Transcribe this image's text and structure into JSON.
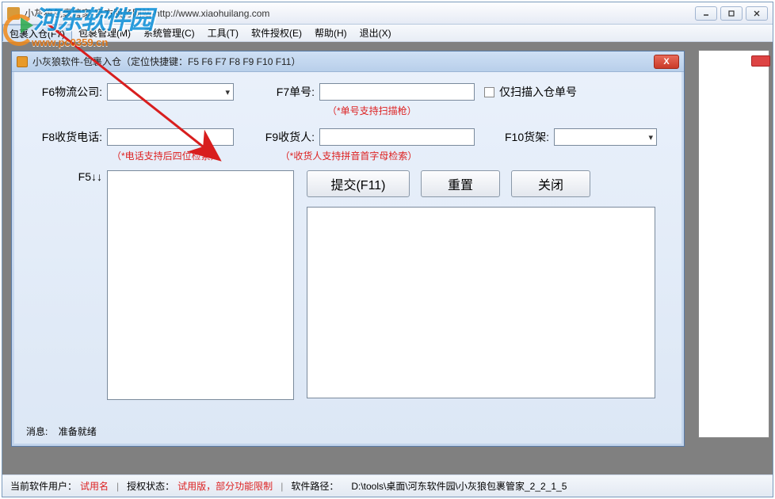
{
  "outer": {
    "title": "小灰狼包裹管家-官方服务网站-http://www.xiaohuilang.com"
  },
  "menu": {
    "items": [
      "包裹入仓(F7)",
      "包裹管理(M)",
      "系统管理(C)",
      "工具(T)",
      "软件授权(E)",
      "帮助(H)",
      "退出(X)"
    ]
  },
  "dialog": {
    "title": "小灰狼软件-包裹入仓（定位快捷键：F5 F6 F7 F8 F9 F10 F11）",
    "f6_label": "F6物流公司:",
    "f7_label": "F7单号:",
    "f7_hint": "（*单号支持扫描枪）",
    "scan_only_label": "仅扫描入仓单号",
    "f8_label": "F8收货电话:",
    "f8_hint": "（*电话支持后四位检索）",
    "f9_label": "F9收货人:",
    "f9_hint": "（*收货人支持拼音首字母检索）",
    "f10_label": "F10货架:",
    "f5_label": "F5↓↓",
    "submit_btn": "提交(F11)",
    "reset_btn": "重置",
    "close_btn": "关闭",
    "msg_label": "消息:",
    "msg_value": "准备就绪"
  },
  "status": {
    "user_label": "当前软件用户：",
    "user_value": "试用名",
    "auth_label": "授权状态：",
    "auth_value": "试用版，部分功能限制",
    "path_label": "软件路径：",
    "path_value": "D:\\tools\\桌面\\河东软件园\\小灰狼包裹管家_2_2_1_5"
  },
  "watermark": {
    "brand": "河东软件园",
    "url": "www.pc0359.cn"
  }
}
